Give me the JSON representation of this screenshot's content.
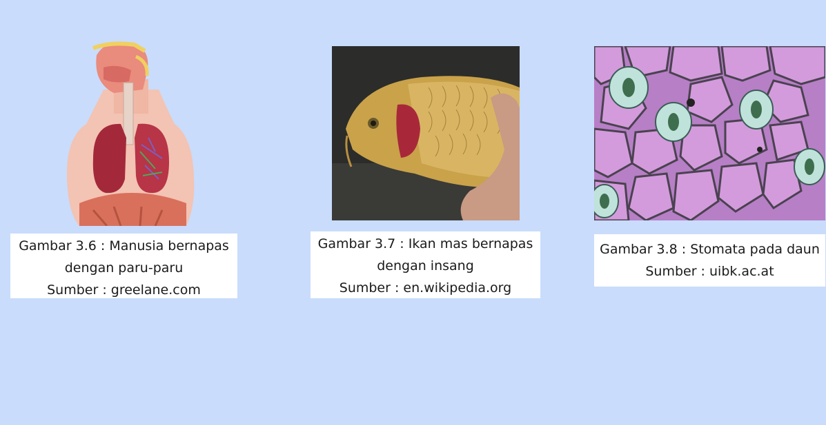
{
  "slide": {
    "background": "#c9dcfb",
    "figures": [
      {
        "image_icon": "human-respiratory-system-illustration",
        "caption_lines": [
          "Gambar 3.6 : Manusia bernapas",
          "dengan paru-paru",
          "Sumber : greelane.com"
        ]
      },
      {
        "image_icon": "carp-fish-gill-photo",
        "caption_lines": [
          "Gambar 3.7 : Ikan mas bernapas",
          "dengan insang",
          "Sumber : en.wikipedia.org"
        ]
      },
      {
        "image_icon": "leaf-stomata-microscope-photo",
        "caption_lines": [
          "Gambar 3.8 : Stomata pada daun",
          "Sumber : uibk.ac.at"
        ]
      }
    ]
  }
}
